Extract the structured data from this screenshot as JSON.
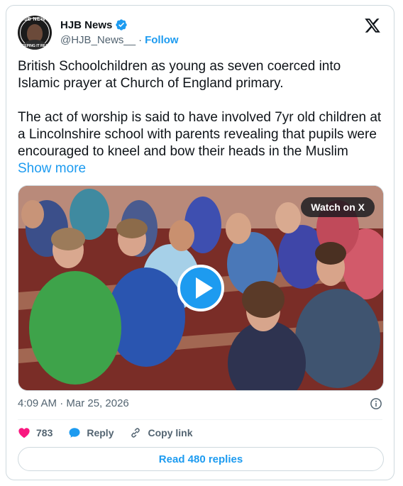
{
  "post": {
    "display_name": "HJB News",
    "handle": "@HJB_News__",
    "separator": "·",
    "follow_label": "Follow",
    "avatar_text_top": "HJB NEWS",
    "avatar_text_bottom": "KEEPING IT REAL",
    "text": "British Schoolchildren as young as seven coerced into Islamic prayer at Church of England primary.\n\nThe act of worship is said to have involved 7yr old children at a Lincolnshire school with parents revealing that pupils were encouraged to kneel and bow their heads in the Muslim ",
    "show_more_label": "Show more",
    "timestamp": "4:09 AM · Mar 25, 2026"
  },
  "media": {
    "watch_label": "Watch on X",
    "icon": "play-icon"
  },
  "actions": {
    "likes_count": "783",
    "reply_label": "Reply",
    "copy_link_label": "Copy link"
  },
  "footer": {
    "read_replies_label": "Read 480 replies"
  },
  "colors": {
    "accent": "#1d9bf0",
    "like": "#f91880",
    "verified": "#1d9bf0",
    "muted": "#536471"
  },
  "icons": [
    "verified-badge-icon",
    "x-logo-icon",
    "info-icon",
    "heart-icon",
    "reply-bubble-icon",
    "link-icon"
  ]
}
